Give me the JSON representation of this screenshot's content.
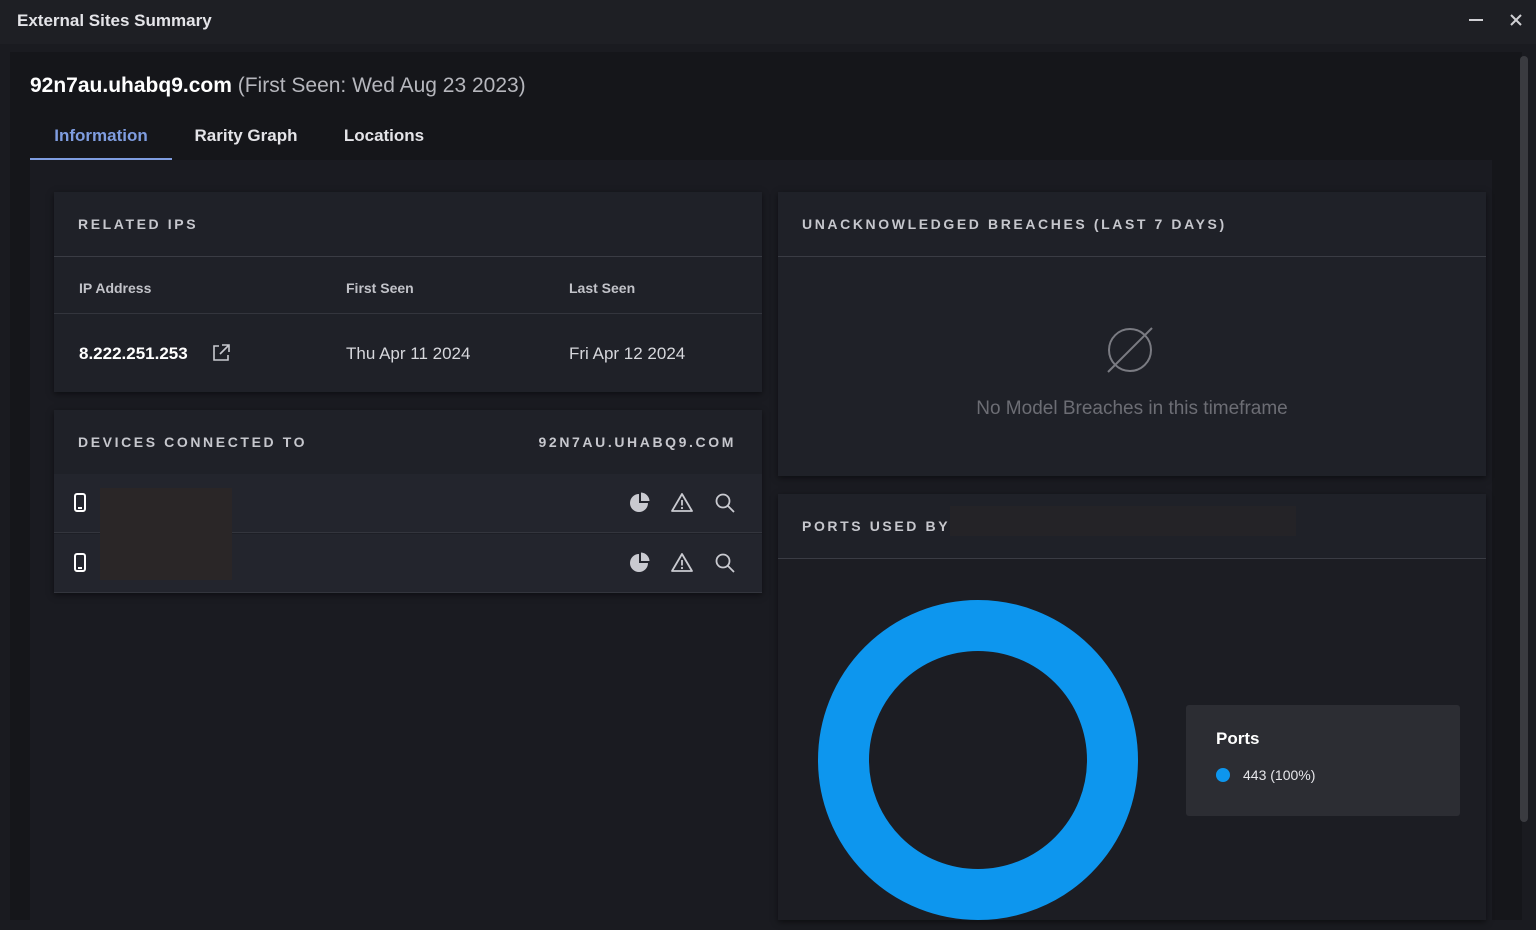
{
  "window": {
    "title": "External Sites Summary",
    "minimize_label": "—",
    "close_label": "✕"
  },
  "heading": {
    "hostname": "92n7au.uhabq9.com",
    "first_seen": "(First Seen: Wed Aug 23 2023)"
  },
  "tabs": [
    {
      "label": "Information",
      "active": true
    },
    {
      "label": "Rarity Graph",
      "active": false
    },
    {
      "label": "Locations",
      "active": false
    }
  ],
  "related_ips": {
    "title": "RELATED IPS",
    "columns": [
      "IP Address",
      "First Seen",
      "Last Seen"
    ],
    "rows": [
      {
        "ip": "8.222.251.253",
        "first_seen": "Thu Apr 11 2024",
        "last_seen": "Fri Apr 12 2024"
      }
    ]
  },
  "devices": {
    "title": "DEVICES CONNECTED TO",
    "target": "92N7AU.UHABQ9.COM",
    "rows": [
      {
        "icon": "mobile-device-icon",
        "name_redacted": true
      },
      {
        "icon": "mobile-device-icon",
        "name_redacted": true
      }
    ]
  },
  "breaches": {
    "title": "UNACKNOWLEDGED BREACHES (LAST 7 DAYS)",
    "empty_message": "No Model Breaches in this timeframe"
  },
  "ports": {
    "title": "PORTS USED BY",
    "legend_title": "Ports",
    "items": [
      {
        "label": "443 (100%)",
        "color": "#0d96ee"
      }
    ]
  },
  "chart_data": {
    "type": "pie",
    "donut": true,
    "title": "",
    "categories": [
      "443"
    ],
    "values": [
      100
    ],
    "colors": [
      "#0d96ee"
    ],
    "legend": "right"
  },
  "colors": {
    "accent": "#7f9de0",
    "port_443": "#0d96ee"
  }
}
